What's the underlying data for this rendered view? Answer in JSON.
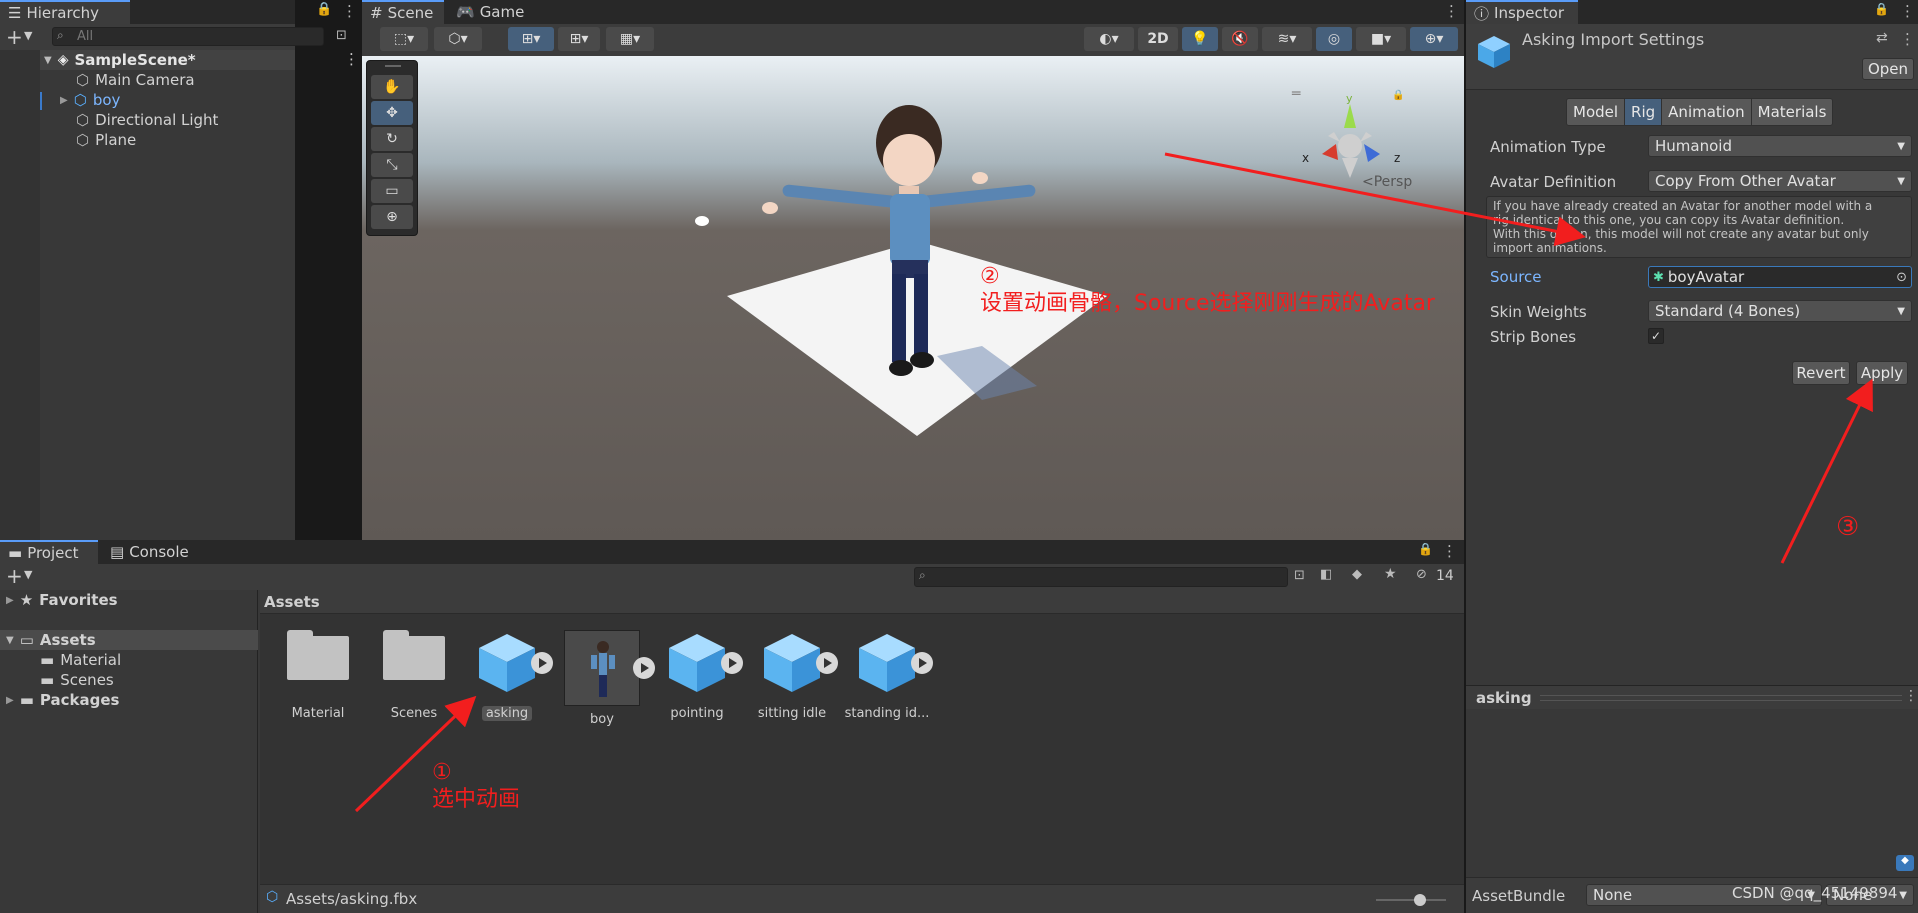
{
  "hierarchy": {
    "tab": "Hierarchy",
    "search_placeholder": "All",
    "scene": "SampleScene*",
    "items": [
      "Main Camera",
      "boy",
      "Directional Light",
      "Plane"
    ]
  },
  "scene_view": {
    "tabs": [
      "Scene",
      "Game"
    ],
    "btn_2d": "2D",
    "persp": "Persp",
    "axis_x": "x",
    "axis_z": "z",
    "axis_y": "y"
  },
  "inspector": {
    "tab": "Inspector",
    "title": "Asking Import Settings",
    "open": "Open",
    "tabs": [
      "Model",
      "Rig",
      "Animation",
      "Materials"
    ],
    "active_tab": "Rig",
    "animation_type_label": "Animation Type",
    "animation_type_value": "Humanoid",
    "avatar_def_label": "Avatar Definition",
    "avatar_def_value": "Copy From Other Avatar",
    "help_line1": "If you have already created an Avatar for another model with a",
    "help_line2": "rig identical to this one, you can copy its Avatar definition.",
    "help_line3": "With this option, this model will not create any avatar but only",
    "help_line4": "import animations.",
    "source_label": "Source",
    "source_value": "boyAvatar",
    "skin_label": "Skin Weights",
    "skin_value": "Standard (4 Bones)",
    "strip_label": "Strip Bones",
    "revert": "Revert",
    "apply": "Apply",
    "preview_title": "asking",
    "assetbundle_label": "AssetBundle",
    "assetbundle_value": "None",
    "assetbundle_variant": "None"
  },
  "project": {
    "tabs": [
      "Project",
      "Console"
    ],
    "hidden_count": "14",
    "tree": [
      "Favorites",
      "Assets",
      "Material",
      "Scenes",
      "Packages"
    ],
    "breadcrumb": "Assets",
    "assets": [
      "Material",
      "Scenes",
      "asking",
      "boy",
      "pointing",
      "sitting idle",
      "standing id..."
    ],
    "footer_path": "Assets/asking.fbx"
  },
  "annotations": {
    "a1_num": "①",
    "a1_text": "选中动画",
    "a2_num": "②",
    "a2_text": "设置动画骨骼，Source选择刚刚生成的Avatar",
    "a3_num": "③"
  },
  "watermark": "CSDN @qq_45149894"
}
